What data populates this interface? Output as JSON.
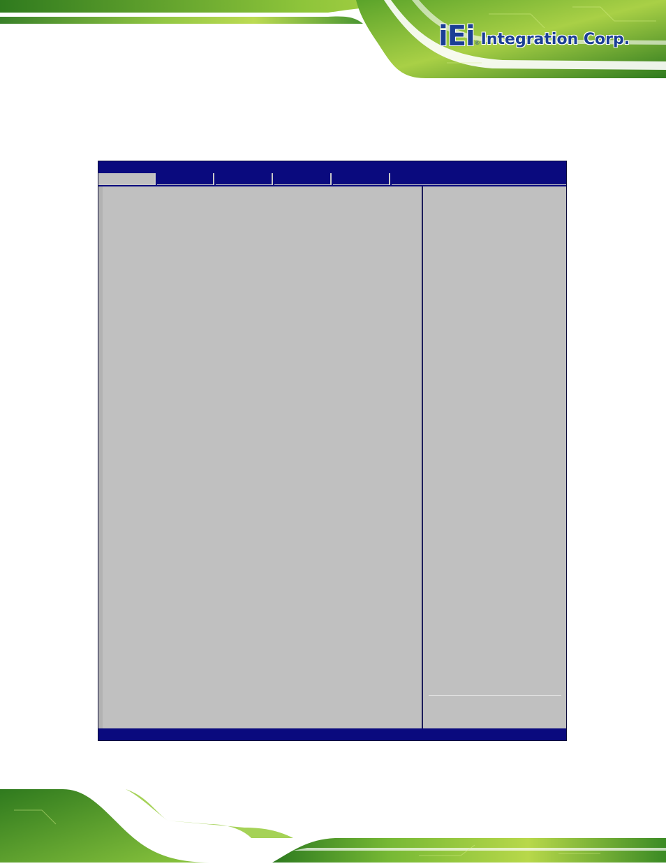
{
  "brand": {
    "logo_mark": "iEi",
    "logo_text": "Integration Corp.",
    "colors": {
      "brand_blue": "#1b3f95",
      "banner_green": "#6ab52a"
    }
  },
  "bios": {
    "title": "",
    "tabs": [
      {
        "label": "",
        "active": true
      },
      {
        "label": "",
        "active": false
      },
      {
        "label": "",
        "active": false
      },
      {
        "label": "",
        "active": false
      },
      {
        "label": "",
        "active": false
      }
    ],
    "status_text": "",
    "colors": {
      "frame": "#0a0a7e",
      "pane": "#c0c0c0"
    }
  }
}
